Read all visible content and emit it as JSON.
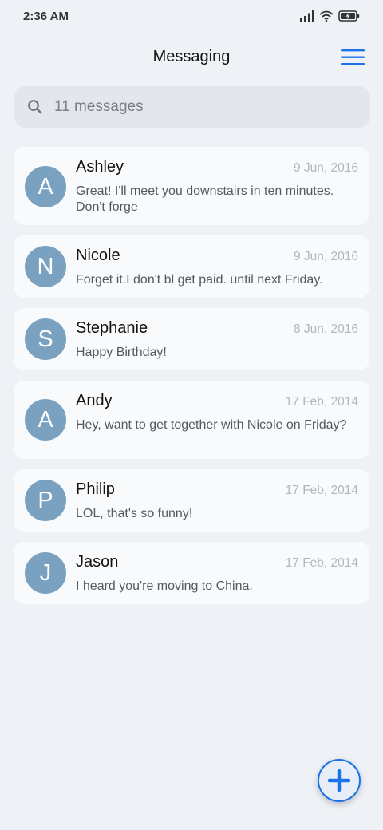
{
  "status_bar": {
    "time": "2:36 AM",
    "icons": [
      "signal-icon",
      "wifi-icon",
      "battery-charging-icon"
    ]
  },
  "header": {
    "title": "Messaging",
    "menu_icon": "hamburger-menu-icon"
  },
  "search": {
    "placeholder": "11 messages",
    "icon": "search-icon"
  },
  "messages": [
    {
      "initial": "A",
      "name": "Ashley",
      "date": "9 Jun, 2016",
      "preview": "Great! I'll meet you downstairs in ten minutes. Don't forge"
    },
    {
      "initial": "N",
      "name": "Nicole",
      "date": "9 Jun, 2016",
      "preview": "Forget it.I don't bl get paid. until next Friday."
    },
    {
      "initial": "S",
      "name": "Stephanie",
      "date": "8 Jun, 2016",
      "preview": "Happy Birthday!"
    },
    {
      "initial": "A",
      "name": "Andy",
      "date": "17 Feb, 2014",
      "preview": "Hey, want to get together with Nicole on Friday?"
    },
    {
      "initial": "P",
      "name": "Philip",
      "date": "17 Feb, 2014",
      "preview": "LOL, that's so funny!"
    },
    {
      "initial": "J",
      "name": "Jason",
      "date": "17 Feb, 2014",
      "preview": "I heard you're moving to China."
    }
  ],
  "fab": {
    "icon": "plus-icon"
  },
  "colors": {
    "accent": "#1a73e8",
    "avatar": "#7aa2c0",
    "background": "#eef1f5",
    "card": "#f9fafc"
  }
}
